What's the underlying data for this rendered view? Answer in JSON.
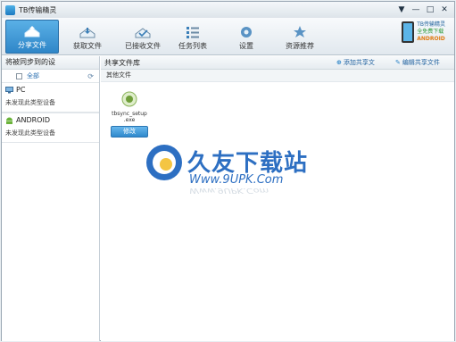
{
  "window": {
    "title": "TB传输精灵"
  },
  "controls": {
    "menu": "▼",
    "minimize": "—",
    "maximize": "□",
    "close": "✕"
  },
  "toolbar": {
    "items": [
      {
        "label": "分享文件",
        "active": true
      },
      {
        "label": "获取文件",
        "active": false
      },
      {
        "label": "已接收文件",
        "active": false
      },
      {
        "label": "任务列表",
        "active": false
      },
      {
        "label": "设置",
        "active": false
      },
      {
        "label": "资源推荐",
        "active": false
      }
    ],
    "brand": {
      "line1": "TB传输精灵",
      "line2": "全免费下载",
      "line3": "ANDROID"
    }
  },
  "sidebar": {
    "header": "将被同步到的设",
    "select_all": "全部",
    "refresh": "⟳",
    "groups": [
      {
        "title": "PC",
        "note": "未发现此类型设备"
      },
      {
        "title": "ANDROID",
        "note": "未发现此类型设备"
      }
    ]
  },
  "main": {
    "header": "共享文件库",
    "add_share": "添加共享文",
    "edit_share": "编辑共享文件",
    "sub_header": "其他文件",
    "file": {
      "name_line1": "tbsync_setup",
      "name_line2": ".exe",
      "button": "修改"
    }
  },
  "watermark": {
    "cn": "久友下载站",
    "url": "Www.9UPK.Com",
    "url_reflection": "Www.9UPK.Com"
  },
  "colors": {
    "accent": "#2f86c8",
    "brand_blue": "#2d6fc2"
  }
}
